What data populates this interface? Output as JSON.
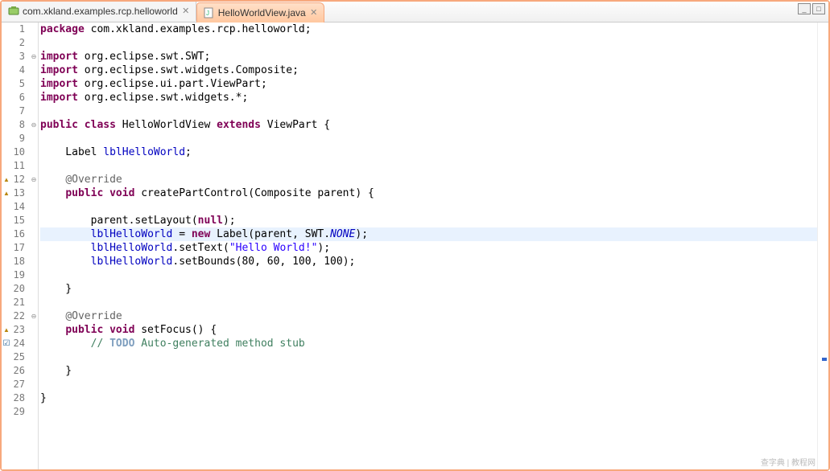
{
  "tabs": [
    {
      "label": "com.xkland.examples.rcp.helloworld",
      "active": false
    },
    {
      "label": "HelloWorldView.java",
      "active": true
    }
  ],
  "window_controls": {
    "minimize": "_",
    "maximize": "□"
  },
  "highlighted_line": 16,
  "code_lines": [
    {
      "n": 1,
      "marker": "",
      "fold": "",
      "segs": [
        [
          "kw",
          "package"
        ],
        [
          "",
          " com.xkland.examples.rcp.helloworld;"
        ]
      ]
    },
    {
      "n": 2,
      "marker": "",
      "fold": "",
      "segs": []
    },
    {
      "n": 3,
      "marker": "",
      "fold": "⊖",
      "segs": [
        [
          "kw",
          "import"
        ],
        [
          "",
          " org.eclipse.swt.SWT;"
        ]
      ]
    },
    {
      "n": 4,
      "marker": "",
      "fold": "",
      "segs": [
        [
          "kw",
          "import"
        ],
        [
          "",
          " org.eclipse.swt.widgets.Composite;"
        ]
      ]
    },
    {
      "n": 5,
      "marker": "",
      "fold": "",
      "segs": [
        [
          "kw",
          "import"
        ],
        [
          "",
          " org.eclipse.ui.part.ViewPart;"
        ]
      ]
    },
    {
      "n": 6,
      "marker": "",
      "fold": "",
      "segs": [
        [
          "kw",
          "import"
        ],
        [
          "",
          " org.eclipse.swt.widgets.*;"
        ]
      ]
    },
    {
      "n": 7,
      "marker": "",
      "fold": "",
      "segs": []
    },
    {
      "n": 8,
      "marker": "",
      "fold": "⊖",
      "segs": [
        [
          "kw",
          "public class"
        ],
        [
          "",
          " HelloWorldView "
        ],
        [
          "kw",
          "extends"
        ],
        [
          "",
          " ViewPart {"
        ]
      ]
    },
    {
      "n": 9,
      "marker": "",
      "fold": "",
      "segs": []
    },
    {
      "n": 10,
      "marker": "",
      "fold": "",
      "segs": [
        [
          "",
          "    Label "
        ],
        [
          "field",
          "lblHelloWorld"
        ],
        [
          "",
          ";"
        ]
      ]
    },
    {
      "n": 11,
      "marker": "",
      "fold": "",
      "segs": []
    },
    {
      "n": 12,
      "marker": "▲",
      "fold": "⊖",
      "segs": [
        [
          "",
          "    "
        ],
        [
          "ann",
          "@Override"
        ]
      ]
    },
    {
      "n": 13,
      "marker": "▲",
      "fold": "",
      "segs": [
        [
          "",
          "    "
        ],
        [
          "kw",
          "public void"
        ],
        [
          "",
          " createPartControl(Composite parent) {"
        ]
      ]
    },
    {
      "n": 14,
      "marker": "",
      "fold": "",
      "segs": []
    },
    {
      "n": 15,
      "marker": "",
      "fold": "",
      "segs": [
        [
          "",
          "        parent.setLayout("
        ],
        [
          "kw",
          "null"
        ],
        [
          "",
          ");"
        ]
      ]
    },
    {
      "n": 16,
      "marker": "",
      "fold": "",
      "segs": [
        [
          "",
          "        "
        ],
        [
          "field",
          "lblHelloWorld"
        ],
        [
          "",
          " = "
        ],
        [
          "kw",
          "new"
        ],
        [
          "",
          " Label(parent, SWT."
        ],
        [
          "staticfield",
          "NONE"
        ],
        [
          "",
          ");"
        ]
      ]
    },
    {
      "n": 17,
      "marker": "",
      "fold": "",
      "segs": [
        [
          "",
          "        "
        ],
        [
          "field",
          "lblHelloWorld"
        ],
        [
          "",
          ".setText("
        ],
        [
          "str",
          "\"Hello World!\""
        ],
        [
          "",
          ");"
        ]
      ]
    },
    {
      "n": 18,
      "marker": "",
      "fold": "",
      "segs": [
        [
          "",
          "        "
        ],
        [
          "field",
          "lblHelloWorld"
        ],
        [
          "",
          ".setBounds(80, 60, 100, 100);"
        ]
      ]
    },
    {
      "n": 19,
      "marker": "",
      "fold": "",
      "segs": []
    },
    {
      "n": 20,
      "marker": "",
      "fold": "",
      "segs": [
        [
          "",
          "    }"
        ]
      ]
    },
    {
      "n": 21,
      "marker": "",
      "fold": "",
      "segs": []
    },
    {
      "n": 22,
      "marker": "",
      "fold": "⊖",
      "segs": [
        [
          "",
          "    "
        ],
        [
          "ann",
          "@Override"
        ]
      ]
    },
    {
      "n": 23,
      "marker": "▲",
      "fold": "",
      "segs": [
        [
          "",
          "    "
        ],
        [
          "kw",
          "public void"
        ],
        [
          "",
          " setFocus() {"
        ]
      ]
    },
    {
      "n": 24,
      "marker": "☑",
      "fold": "",
      "segs": [
        [
          "",
          "        "
        ],
        [
          "cmt",
          "// "
        ],
        [
          "todo",
          "TODO"
        ],
        [
          "cmt",
          " Auto-generated method stub"
        ]
      ]
    },
    {
      "n": 25,
      "marker": "",
      "fold": "",
      "segs": []
    },
    {
      "n": 26,
      "marker": "",
      "fold": "",
      "segs": [
        [
          "",
          "    }"
        ]
      ]
    },
    {
      "n": 27,
      "marker": "",
      "fold": "",
      "segs": []
    },
    {
      "n": 28,
      "marker": "",
      "fold": "",
      "segs": [
        [
          "",
          "}"
        ]
      ]
    },
    {
      "n": 29,
      "marker": "",
      "fold": "",
      "segs": []
    }
  ],
  "overview_marks": [
    {
      "top_pct": 75,
      "cls": "ov-blue"
    }
  ],
  "watermark": "查字典 | 教程网"
}
